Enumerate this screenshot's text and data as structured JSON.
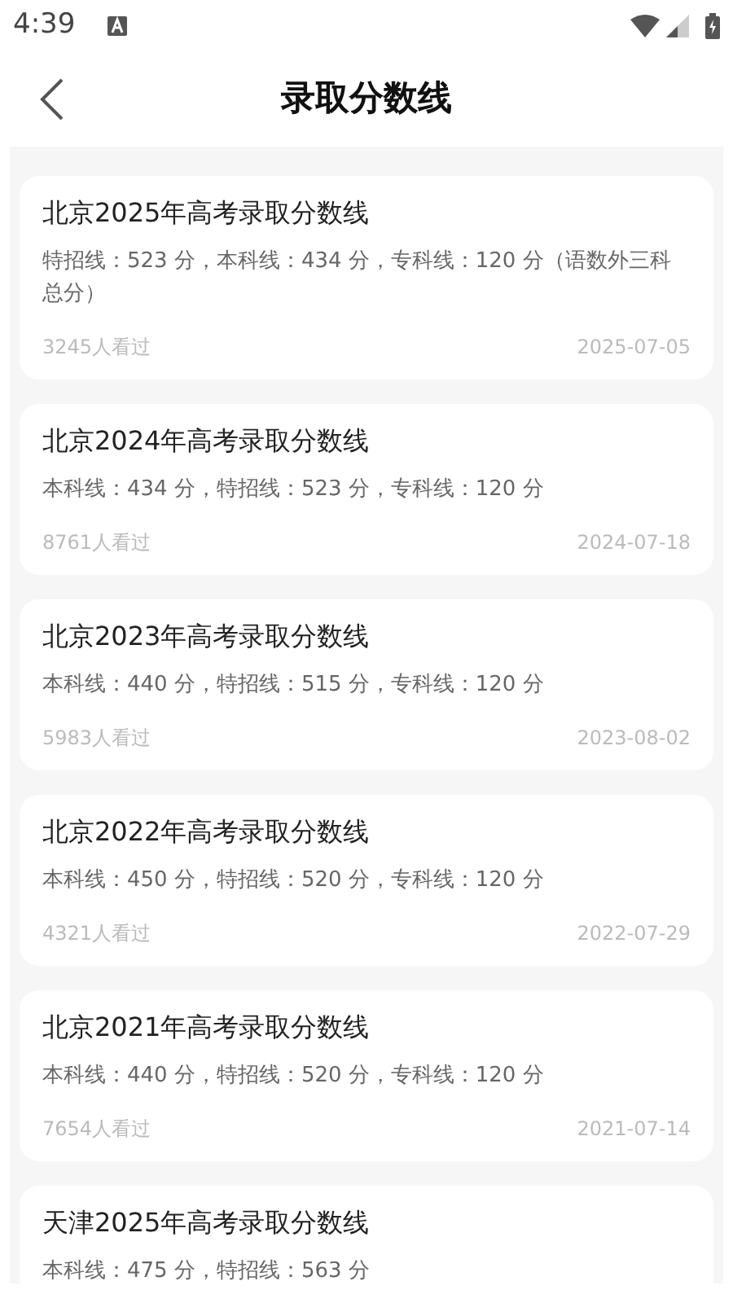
{
  "status_bar": {
    "time": "4:39"
  },
  "header": {
    "title": "录取分数线"
  },
  "items": [
    {
      "title": "北京2025年高考录取分数线",
      "detail": "特招线：523 分，本科线：434 分，专科线：120 分（语数外三科总分）",
      "views": "3245人看过",
      "date": "2025-07-05"
    },
    {
      "title": "北京2024年高考录取分数线",
      "detail": "本科线：434 分，特招线：523 分，专科线：120 分",
      "views": "8761人看过",
      "date": "2024-07-18"
    },
    {
      "title": "北京2023年高考录取分数线",
      "detail": "本科线：440 分，特招线：515 分，专科线：120 分",
      "views": "5983人看过",
      "date": "2023-08-02"
    },
    {
      "title": "北京2022年高考录取分数线",
      "detail": "本科线：450 分，特招线：520 分，专科线：120 分",
      "views": "4321人看过",
      "date": "2022-07-29"
    },
    {
      "title": "北京2021年高考录取分数线",
      "detail": "本科线：440 分，特招线：520 分，专科线：120 分",
      "views": "7654人看过",
      "date": "2021-07-14"
    },
    {
      "title": "天津2025年高考录取分数线",
      "detail": "本科线：475 分，特招线：563 分"
    }
  ]
}
